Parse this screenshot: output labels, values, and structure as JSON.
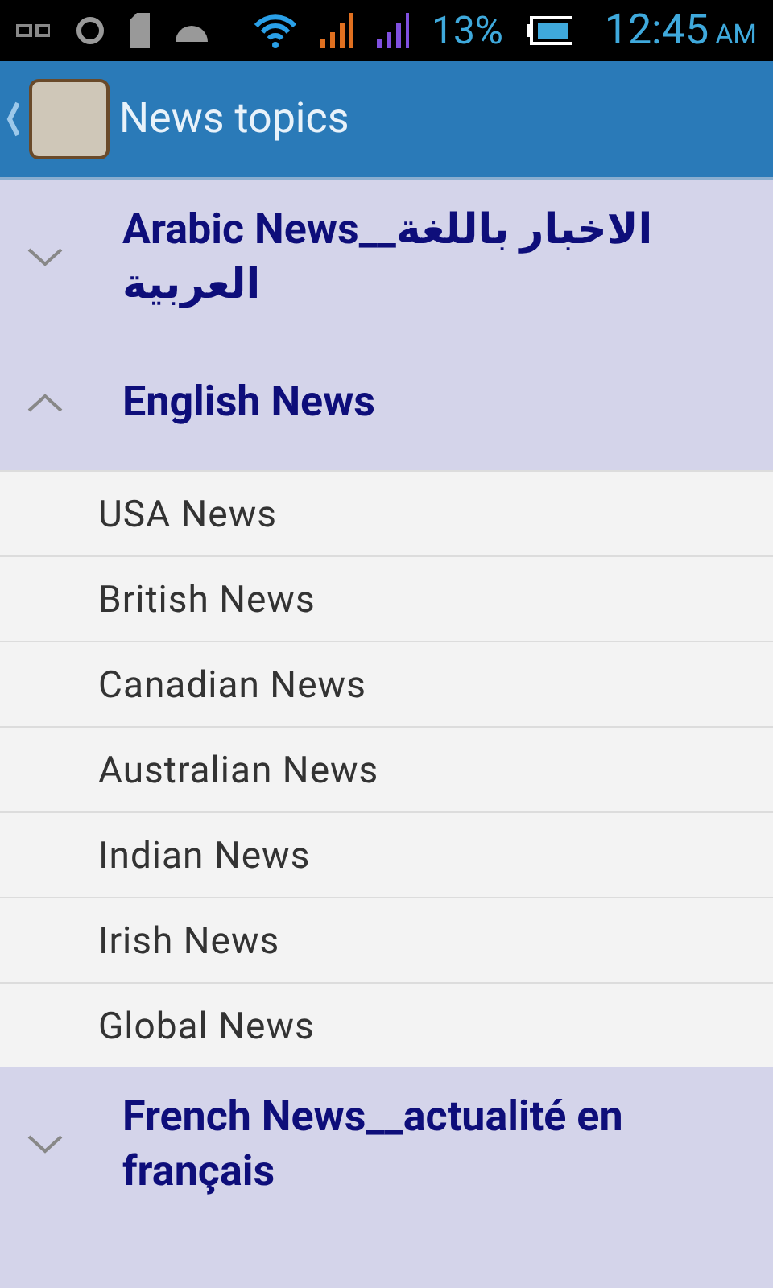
{
  "status_bar": {
    "battery_percent": "13%",
    "time": "12:45",
    "am_pm": "AM"
  },
  "app_bar": {
    "title": "News topics"
  },
  "groups": [
    {
      "label": "Arabic News__الاخبار باللغة العربية",
      "expanded": false
    },
    {
      "label": "English News",
      "expanded": true,
      "children": [
        {
          "label": "USA News"
        },
        {
          "label": "British News"
        },
        {
          "label": "Canadian News"
        },
        {
          "label": "Australian News"
        },
        {
          "label": "Indian News"
        },
        {
          "label": "Irish News"
        },
        {
          "label": "Global News"
        }
      ]
    },
    {
      "label": "French News__actualité en français",
      "expanded": false
    }
  ]
}
